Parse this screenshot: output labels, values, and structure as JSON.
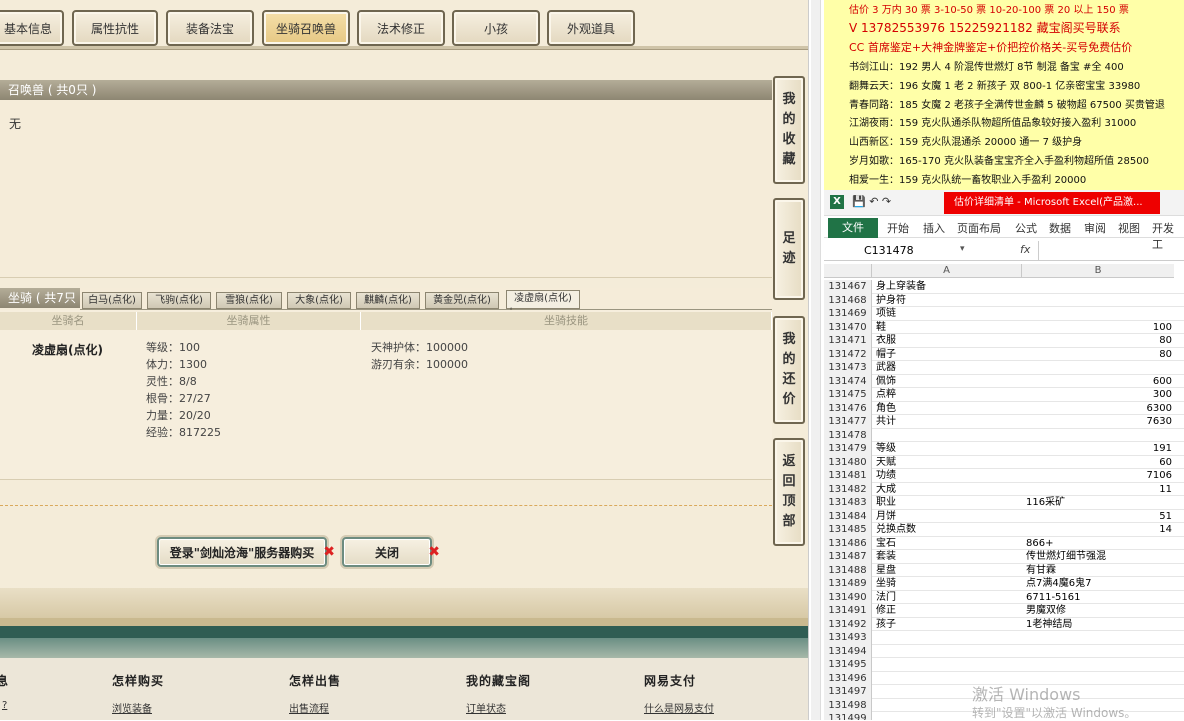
{
  "tabs": [
    "基本信息",
    "属性抗性",
    "装备法宝",
    "坐骑召唤兽",
    "法术修正",
    "小孩",
    "外观道具"
  ],
  "summon": {
    "header": "召唤兽 ( 共0只 )",
    "empty": "无"
  },
  "side_buttons": [
    [
      "我",
      "的",
      "收",
      "藏"
    ],
    [
      "足",
      "迹"
    ],
    [
      "我",
      "的",
      "还",
      "价"
    ],
    [
      "返",
      "回",
      "顶",
      "部"
    ]
  ],
  "mount": {
    "header": "坐骑 ( 共7只 )",
    "subtabs": [
      "白马(点化)",
      "飞驹(点化)",
      "雪狼(点化)",
      "大象(点化)",
      "麒麟(点化)",
      "黄金兕(点化)",
      "凌虚扇(点化)"
    ],
    "columns": [
      "坐骑名",
      "坐骑属性",
      "坐骑技能"
    ],
    "name": "凌虚扇(点化)",
    "attrs": [
      "等级：100",
      "体力：1300",
      "灵性：8/8",
      "根骨：27/27",
      "力量：20/20",
      "经验：817225"
    ],
    "skills": [
      "天神护体：100000",
      "游刃有余：100000"
    ]
  },
  "buttons": {
    "login": "登录\"剑灿沧海\"服务器购买",
    "close": "关闭"
  },
  "footer": {
    "cols": [
      "息",
      "怎样购买",
      "怎样出售",
      "我的藏宝阁",
      "网易支付"
    ],
    "links": [
      "?",
      "浏览装备",
      "出售流程",
      "订单状态",
      "什么是网易支付"
    ]
  },
  "ad": {
    "lines": [
      "估价 3 万内 30 票    3-10-50 票    10-20-100 票    20 以上 150 票",
      "V  13782553976     15225921182    藏宝阁买号联系",
      "CC 首席鉴定+大神金牌鉴定+价把控价格关-买号免费估价",
      "书剑江山：192 男人 4 阶混传世燃灯 8节 制混 备宝 #全 400",
      "翻舞云天：196 女魔 1 老 2 新孩子 双 800-1 亿亲密宝宝 33980",
      "青春同路：185 女魔 2 老孩子全满传世金麟 5 破物超 67500 买贵管退",
      "江湖夜雨：159 克火队通杀队物超所值品象较好接入盈利 31000",
      "山西新区：159 克火队混通杀 20000 通一 7 级护身",
      "岁月如歌：165-170 克火队装备宝宝齐全入手盈利物超所值 28500",
      "相爱一生：159 克火队统一畜牧职业入手盈利 20000"
    ],
    "highlight_colors": [
      "#d40000",
      "#d40000",
      "#d40000"
    ]
  },
  "excel": {
    "title": "估价详细清单 - Microsoft Excel(产品激...",
    "menu": [
      "文件",
      "开始",
      "插入",
      "页面布局",
      "公式",
      "数据",
      "审阅",
      "视图",
      "开发工"
    ],
    "cell_ref": "C131478",
    "fx": "fx",
    "col_headers": [
      "A",
      "B"
    ],
    "rows": [
      [
        "131467",
        "身上穿装备",
        ""
      ],
      [
        "131468",
        "护身符",
        ""
      ],
      [
        "131469",
        "项链",
        ""
      ],
      [
        "131470",
        "鞋",
        "100"
      ],
      [
        "131471",
        "衣服",
        "80"
      ],
      [
        "131472",
        "帽子",
        "80"
      ],
      [
        "131473",
        "武器",
        ""
      ],
      [
        "131474",
        "佩饰",
        "600"
      ],
      [
        "131475",
        "点粹",
        "300"
      ],
      [
        "131476",
        "角色",
        "6300"
      ],
      [
        "131477",
        "共计",
        "7630"
      ],
      [
        "131478",
        "",
        ""
      ],
      [
        "131479",
        "等级",
        "191"
      ],
      [
        "131480",
        "天赋",
        "60"
      ],
      [
        "131481",
        "功绩",
        "7106"
      ],
      [
        "131482",
        "大成",
        "11"
      ],
      [
        "131483",
        "职业",
        "116采矿"
      ],
      [
        "131484",
        "月饼",
        "51"
      ],
      [
        "131485",
        "兑换点数",
        "14"
      ],
      [
        "131486",
        "宝石",
        "866+"
      ],
      [
        "131487",
        "套装",
        "传世燃灯细节强混"
      ],
      [
        "131488",
        "星盘",
        "有甘霖"
      ],
      [
        "131489",
        "坐骑",
        "点7满4魔6鬼7"
      ],
      [
        "131490",
        "法门",
        "6711-5161"
      ],
      [
        "131491",
        "修正",
        "男魔双修"
      ],
      [
        "131492",
        "孩子",
        "1老神结局"
      ],
      [
        "131493",
        "",
        ""
      ],
      [
        "131494",
        "",
        ""
      ],
      [
        "131495",
        "",
        ""
      ],
      [
        "131496",
        "",
        ""
      ],
      [
        "131497",
        "",
        ""
      ],
      [
        "131498",
        "",
        ""
      ],
      [
        "131499",
        "",
        ""
      ]
    ]
  },
  "watermark": {
    "line1": "激活 Windows",
    "line2": "转到\"设置\"以激活 Windows。"
  }
}
